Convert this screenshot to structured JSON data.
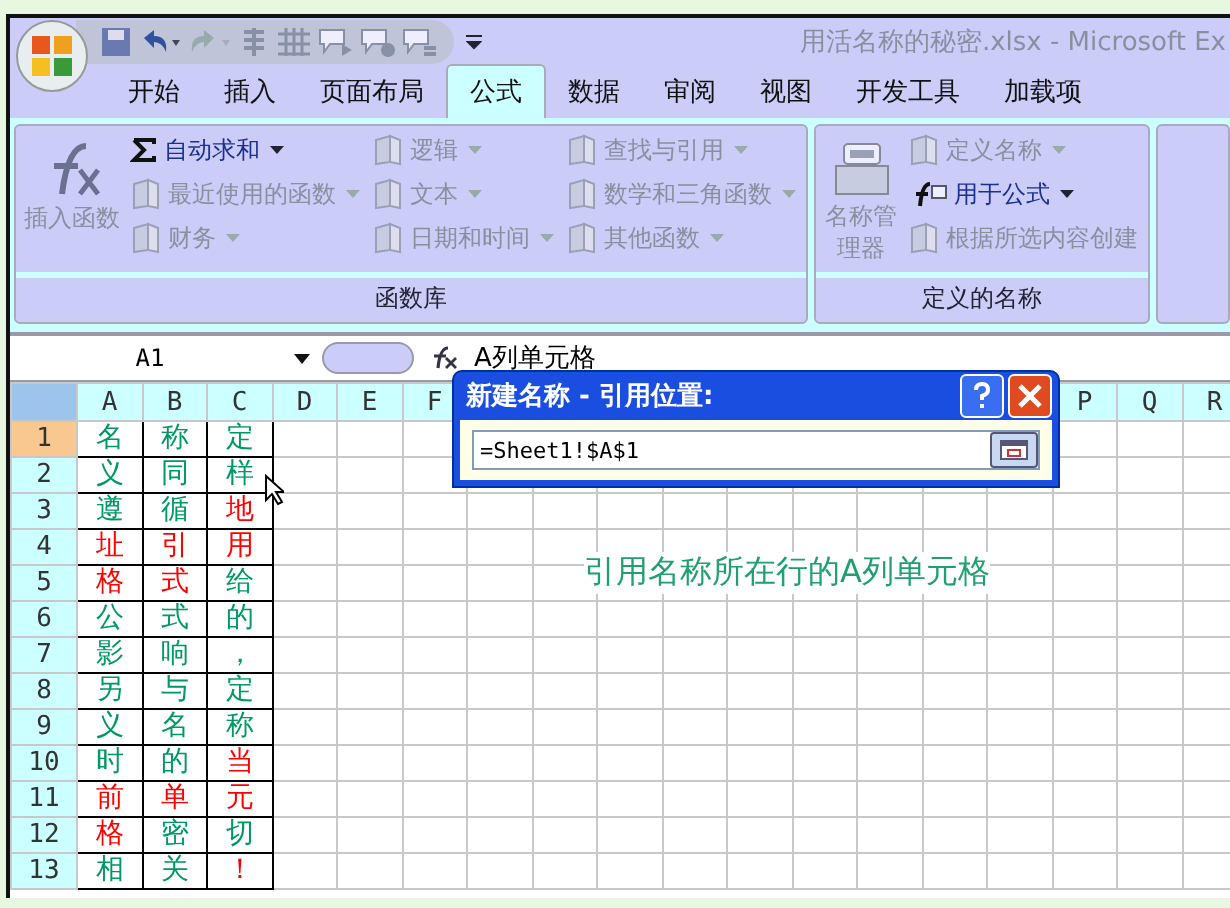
{
  "window": {
    "title": "用活名称的秘密.xlsx - Microsoft Ex"
  },
  "tabs": [
    {
      "label": "开始",
      "selected": false
    },
    {
      "label": "插入",
      "selected": false
    },
    {
      "label": "页面布局",
      "selected": false
    },
    {
      "label": "公式",
      "selected": true
    },
    {
      "label": "数据",
      "selected": false
    },
    {
      "label": "审阅",
      "selected": false
    },
    {
      "label": "视图",
      "selected": false
    },
    {
      "label": "开发工具",
      "selected": false
    },
    {
      "label": "加载项",
      "selected": false
    }
  ],
  "ribbon": {
    "groups": [
      {
        "label": "函数库",
        "large_button": {
          "label": "插入函数",
          "disabled": true
        },
        "columns": [
          [
            {
              "label": "自动求和",
              "dropdown": true,
              "disabled": false
            },
            {
              "label": "最近使用的函数",
              "dropdown": true,
              "disabled": true
            },
            {
              "label": "财务",
              "dropdown": true,
              "disabled": true
            }
          ],
          [
            {
              "label": "逻辑",
              "dropdown": true,
              "disabled": true
            },
            {
              "label": "文本",
              "dropdown": true,
              "disabled": true
            },
            {
              "label": "日期和时间",
              "dropdown": true,
              "disabled": true
            }
          ],
          [
            {
              "label": "查找与引用",
              "dropdown": true,
              "disabled": true
            },
            {
              "label": "数学和三角函数",
              "dropdown": true,
              "disabled": true
            },
            {
              "label": "其他函数",
              "dropdown": true,
              "disabled": true
            }
          ]
        ]
      },
      {
        "label": "定义的名称",
        "large_button": {
          "label": "名称管理器",
          "disabled": true
        },
        "columns": [
          [
            {
              "label": "定义名称",
              "dropdown": true,
              "disabled": true
            },
            {
              "label": "用于公式",
              "dropdown": true,
              "disabled": false
            },
            {
              "label": "根据所选内容创建",
              "dropdown": false,
              "disabled": true
            }
          ]
        ]
      }
    ]
  },
  "formula_bar": {
    "name_box": "A1",
    "formula": "A列单元格"
  },
  "dialog": {
    "title": "新建名称 - 引用位置:",
    "value": "=Sheet1!$A$1"
  },
  "sheet": {
    "column_headers": [
      "A",
      "B",
      "C",
      "D",
      "E",
      "F",
      "P",
      "Q",
      "R"
    ],
    "rows": [
      {
        "number": "1",
        "selected": true,
        "cells": [
          {
            "text": "名",
            "color": "#009966"
          },
          {
            "text": "称",
            "color": "#009966"
          },
          {
            "text": "定",
            "color": "#009966"
          }
        ]
      },
      {
        "number": "2",
        "selected": false,
        "cells": [
          {
            "text": "义",
            "color": "#009966"
          },
          {
            "text": "同",
            "color": "#009966"
          },
          {
            "text": "样",
            "color": "#009966"
          }
        ]
      },
      {
        "number": "3",
        "selected": false,
        "cells": [
          {
            "text": "遵",
            "color": "#009966"
          },
          {
            "text": "循",
            "color": "#009966"
          },
          {
            "text": "地",
            "color": "#ff0000"
          }
        ]
      },
      {
        "number": "4",
        "selected": false,
        "cells": [
          {
            "text": "址",
            "color": "#ff0000"
          },
          {
            "text": "引",
            "color": "#ff0000"
          },
          {
            "text": "用",
            "color": "#ff0000"
          }
        ]
      },
      {
        "number": "5",
        "selected": false,
        "cells": [
          {
            "text": "格",
            "color": "#ff0000"
          },
          {
            "text": "式",
            "color": "#ff0000"
          },
          {
            "text": "给",
            "color": "#009966"
          }
        ]
      },
      {
        "number": "6",
        "selected": false,
        "cells": [
          {
            "text": "公",
            "color": "#009966"
          },
          {
            "text": "式",
            "color": "#009966"
          },
          {
            "text": "的",
            "color": "#009966"
          }
        ]
      },
      {
        "number": "7",
        "selected": false,
        "cells": [
          {
            "text": "影",
            "color": "#009966"
          },
          {
            "text": "响",
            "color": "#009966"
          },
          {
            "text": "，",
            "color": "#009966"
          }
        ]
      },
      {
        "number": "8",
        "selected": false,
        "cells": [
          {
            "text": "另",
            "color": "#009966"
          },
          {
            "text": "与",
            "color": "#009966"
          },
          {
            "text": "定",
            "color": "#009966"
          }
        ]
      },
      {
        "number": "9",
        "selected": false,
        "cells": [
          {
            "text": "义",
            "color": "#009966"
          },
          {
            "text": "名",
            "color": "#009966"
          },
          {
            "text": "称",
            "color": "#009966"
          }
        ]
      },
      {
        "number": "10",
        "selected": false,
        "cells": [
          {
            "text": "时",
            "color": "#009966"
          },
          {
            "text": "的",
            "color": "#009966"
          },
          {
            "text": "当",
            "color": "#ff0000"
          }
        ]
      },
      {
        "number": "11",
        "selected": false,
        "cells": [
          {
            "text": "前",
            "color": "#ff0000"
          },
          {
            "text": "单",
            "color": "#ff0000"
          },
          {
            "text": "元",
            "color": "#ff0000"
          }
        ]
      },
      {
        "number": "12",
        "selected": false,
        "cells": [
          {
            "text": "格",
            "color": "#ff0000"
          },
          {
            "text": "密",
            "color": "#009966"
          },
          {
            "text": "切",
            "color": "#009966"
          }
        ]
      },
      {
        "number": "13",
        "selected": false,
        "cells": [
          {
            "text": "相",
            "color": "#009966"
          },
          {
            "text": "关",
            "color": "#009966"
          },
          {
            "text": "！",
            "color": "#ff0000"
          }
        ]
      }
    ]
  },
  "sheet_note": "引用名称所在行的A列单元格"
}
